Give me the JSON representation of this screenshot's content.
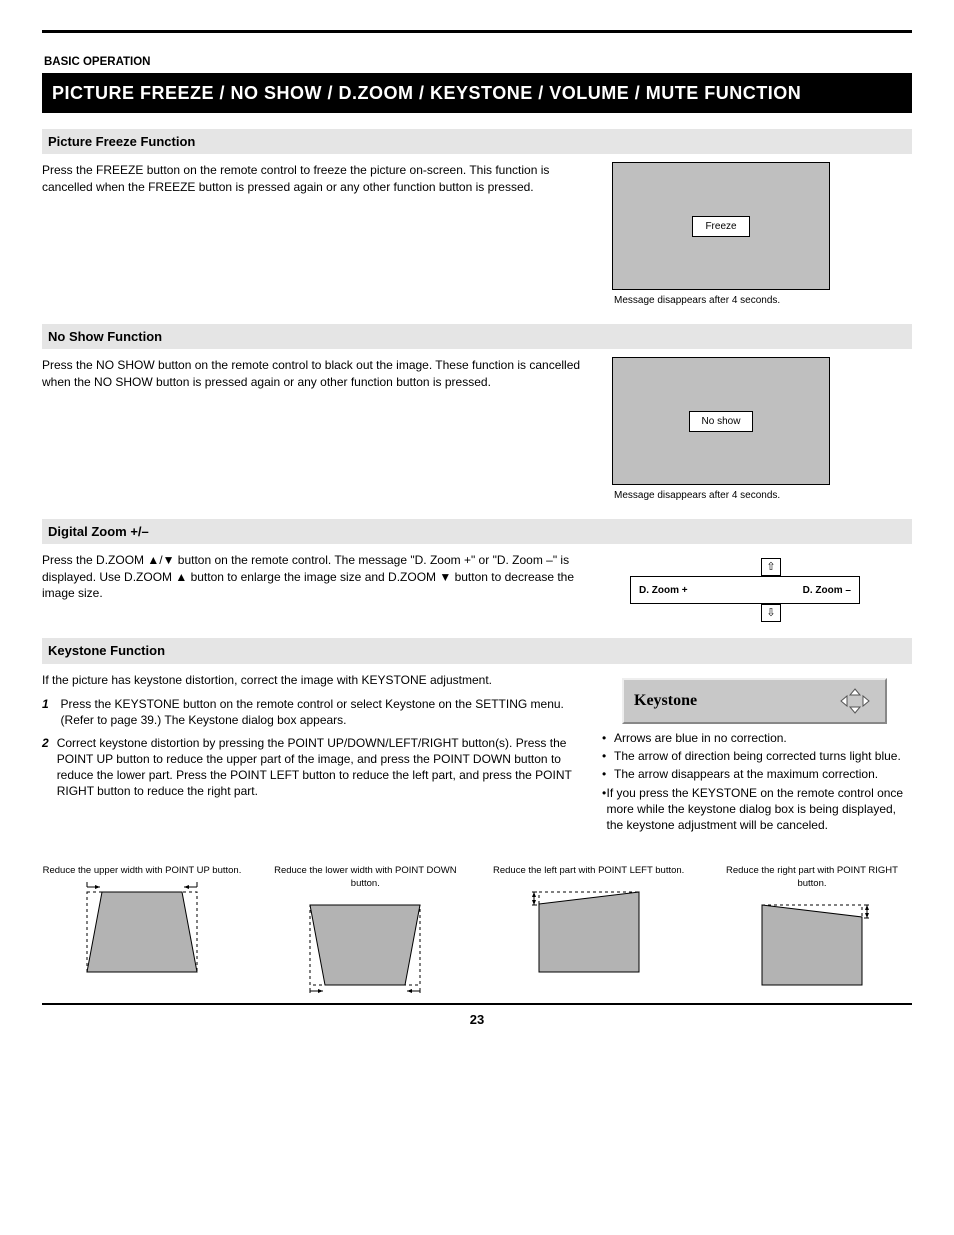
{
  "header": {
    "category": "BASIC OPERATION",
    "title": "PICTURE FREEZE / NO SHOW / D.ZOOM / KEYSTONE / VOLUME / MUTE FUNCTION"
  },
  "sections": {
    "freeze": {
      "title": "Picture Freeze Function",
      "body": "Press the FREEZE button on the remote control to freeze the picture on-screen. This function is cancelled when the FREEZE button is pressed again or any other function button is pressed.",
      "figure": {
        "label": "Freeze",
        "caption": "Message disappears after 4 seconds."
      }
    },
    "noshow": {
      "title": "No Show Function",
      "body": "Press the NO SHOW button on the remote control to black out the image. These function is cancelled when the NO SHOW button is pressed again or any other function button is pressed.",
      "figure": {
        "label": "No show",
        "caption": "Message disappears after 4 seconds."
      }
    },
    "dzoom": {
      "title": "Digital Zoom +/–",
      "body": "Press the D.ZOOM ▲/▼ button on the remote control. The message \"D. Zoom +\" or \"D. Zoom –\" is displayed. Use D.ZOOM ▲ button to enlarge the image size and D.ZOOM ▼ button to decrease the image size.",
      "figure": {
        "plus": "D. Zoom +",
        "minus": "D. Zoom –"
      }
    },
    "keystone": {
      "title": "Keystone Function",
      "intro": "If the picture has keystone distortion, correct the image with KEYSTONE adjustment.",
      "steps": [
        "Press the KEYSTONE button on the remote control or select Keystone on the SETTING menu. (Refer to page 39.) The Keystone dialog box appears.",
        "Correct keystone distortion by pressing the POINT UP/DOWN/LEFT/RIGHT button(s). Press the POINT UP button to reduce the upper part of the image, and press the POINT DOWN button to reduce the lower part. Press the POINT LEFT button to reduce the left part, and press the POINT RIGHT button to reduce the right part."
      ],
      "dialog": {
        "label": "Keystone"
      },
      "notes": [
        "Arrows are blue in no correction.",
        "The arrow of direction being corrected turns light blue.",
        "The arrow disappears at the maximum correction.",
        "If you press the KEYSTONE on the remote control once more while the keystone dialog box is being displayed, the keystone adjustment will be canceled."
      ],
      "trapezoids": [
        "Reduce the upper width with POINT UP button.",
        "Reduce the lower width with POINT DOWN button.",
        "Reduce the left part with POINT LEFT button.",
        "Reduce the right part with POINT RIGHT button."
      ]
    }
  },
  "pageNumber": "23"
}
